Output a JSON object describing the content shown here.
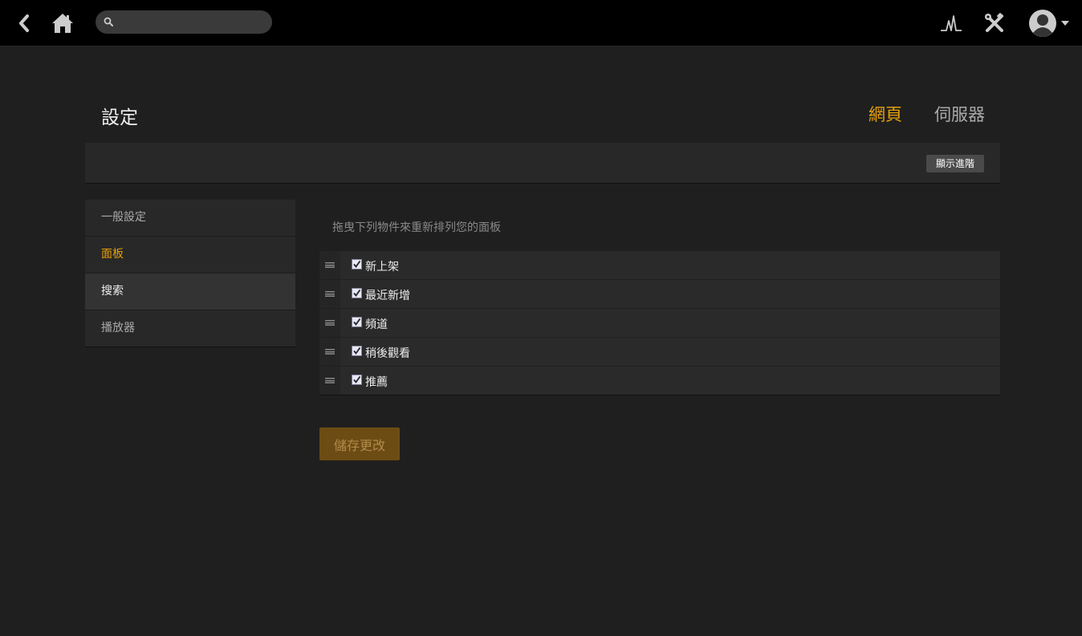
{
  "topbar": {
    "search": {
      "value": "",
      "placeholder": ""
    }
  },
  "header": {
    "title": "設定",
    "tabs": [
      {
        "label": "網頁",
        "active": true
      },
      {
        "label": "伺服器",
        "active": false
      }
    ]
  },
  "toolbar": {
    "advanced_label": "顯示進階"
  },
  "sidebar": {
    "items": [
      {
        "label": "一般設定"
      },
      {
        "label": "面板"
      },
      {
        "label": "搜索"
      },
      {
        "label": "播放器"
      }
    ]
  },
  "main": {
    "hint": "拖曳下列物件來重新排列您的面板",
    "panels": [
      {
        "label": "新上架",
        "checked": true
      },
      {
        "label": "最近新增",
        "checked": true
      },
      {
        "label": "頻道",
        "checked": true
      },
      {
        "label": "稍後觀看",
        "checked": true
      },
      {
        "label": "推薦",
        "checked": true
      }
    ],
    "save_label": "儲存更改"
  },
  "colors": {
    "accent": "#e5a00d",
    "background": "#1f1f1f",
    "topbar": "#000000"
  }
}
